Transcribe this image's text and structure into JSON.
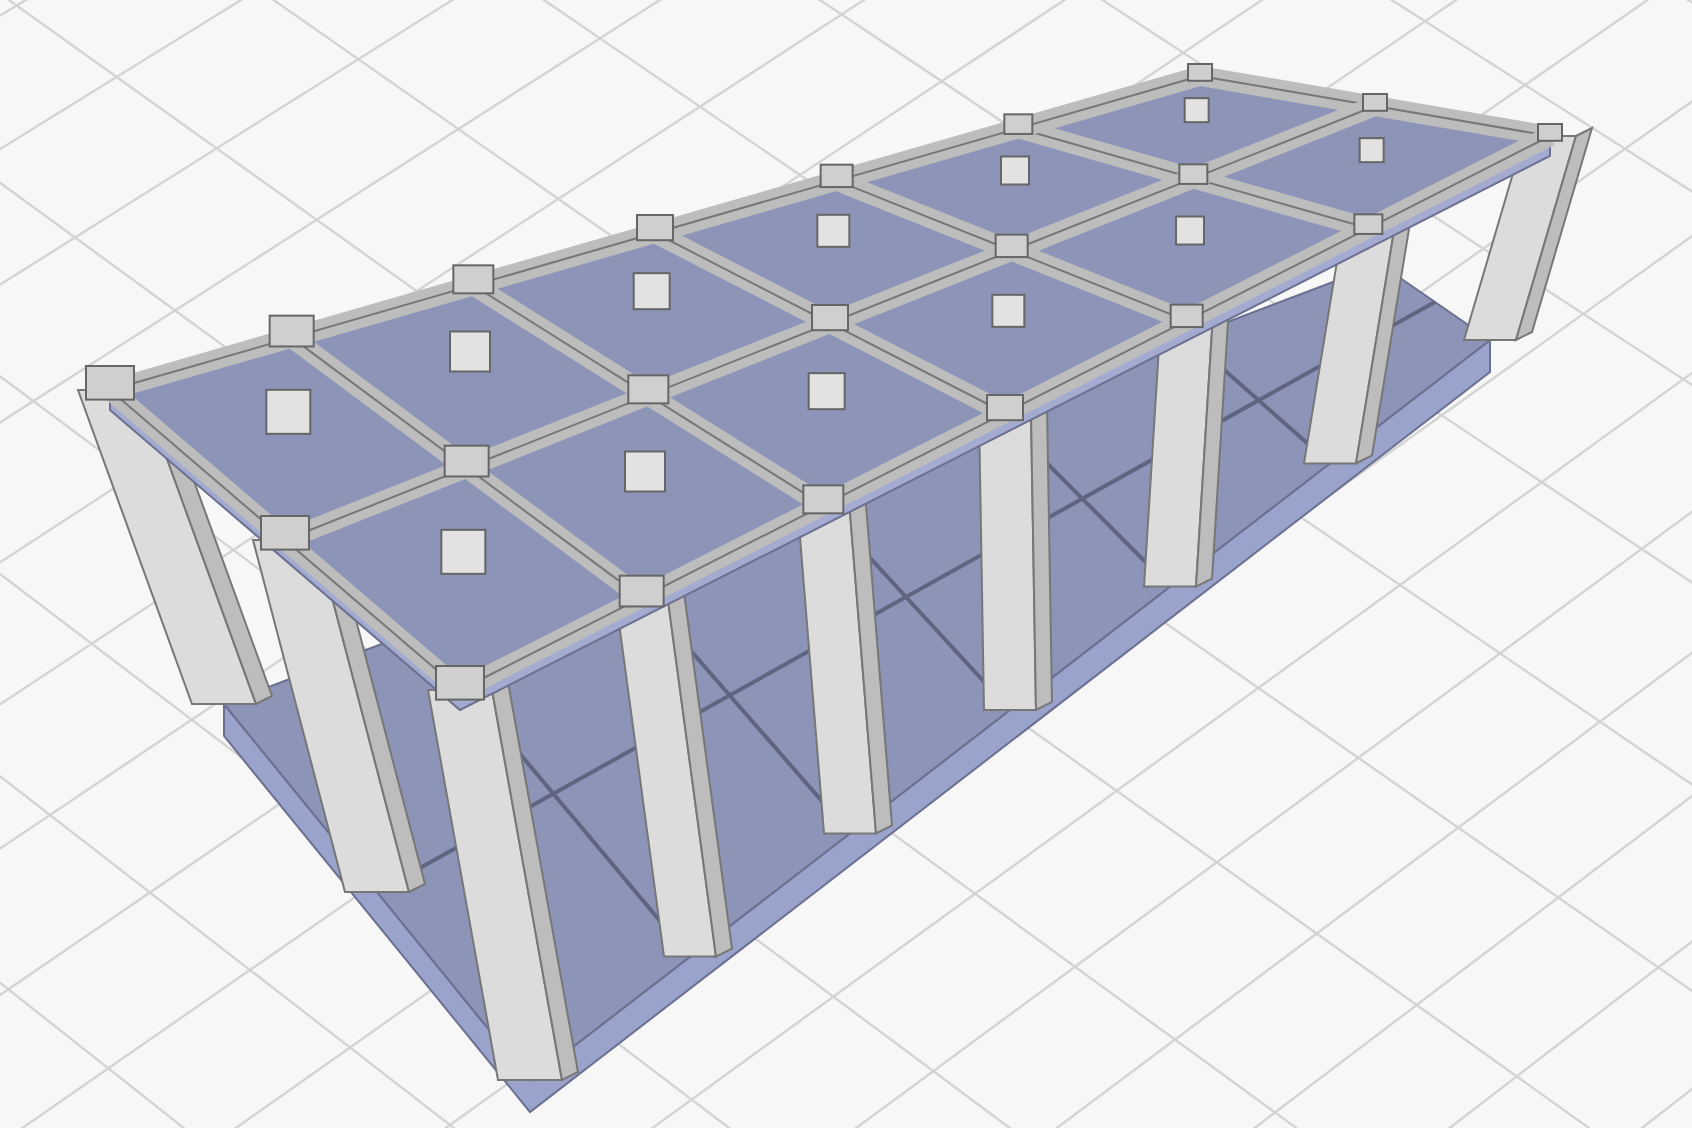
{
  "viewport": {
    "kind": "structural-frame",
    "grid": true
  }
}
